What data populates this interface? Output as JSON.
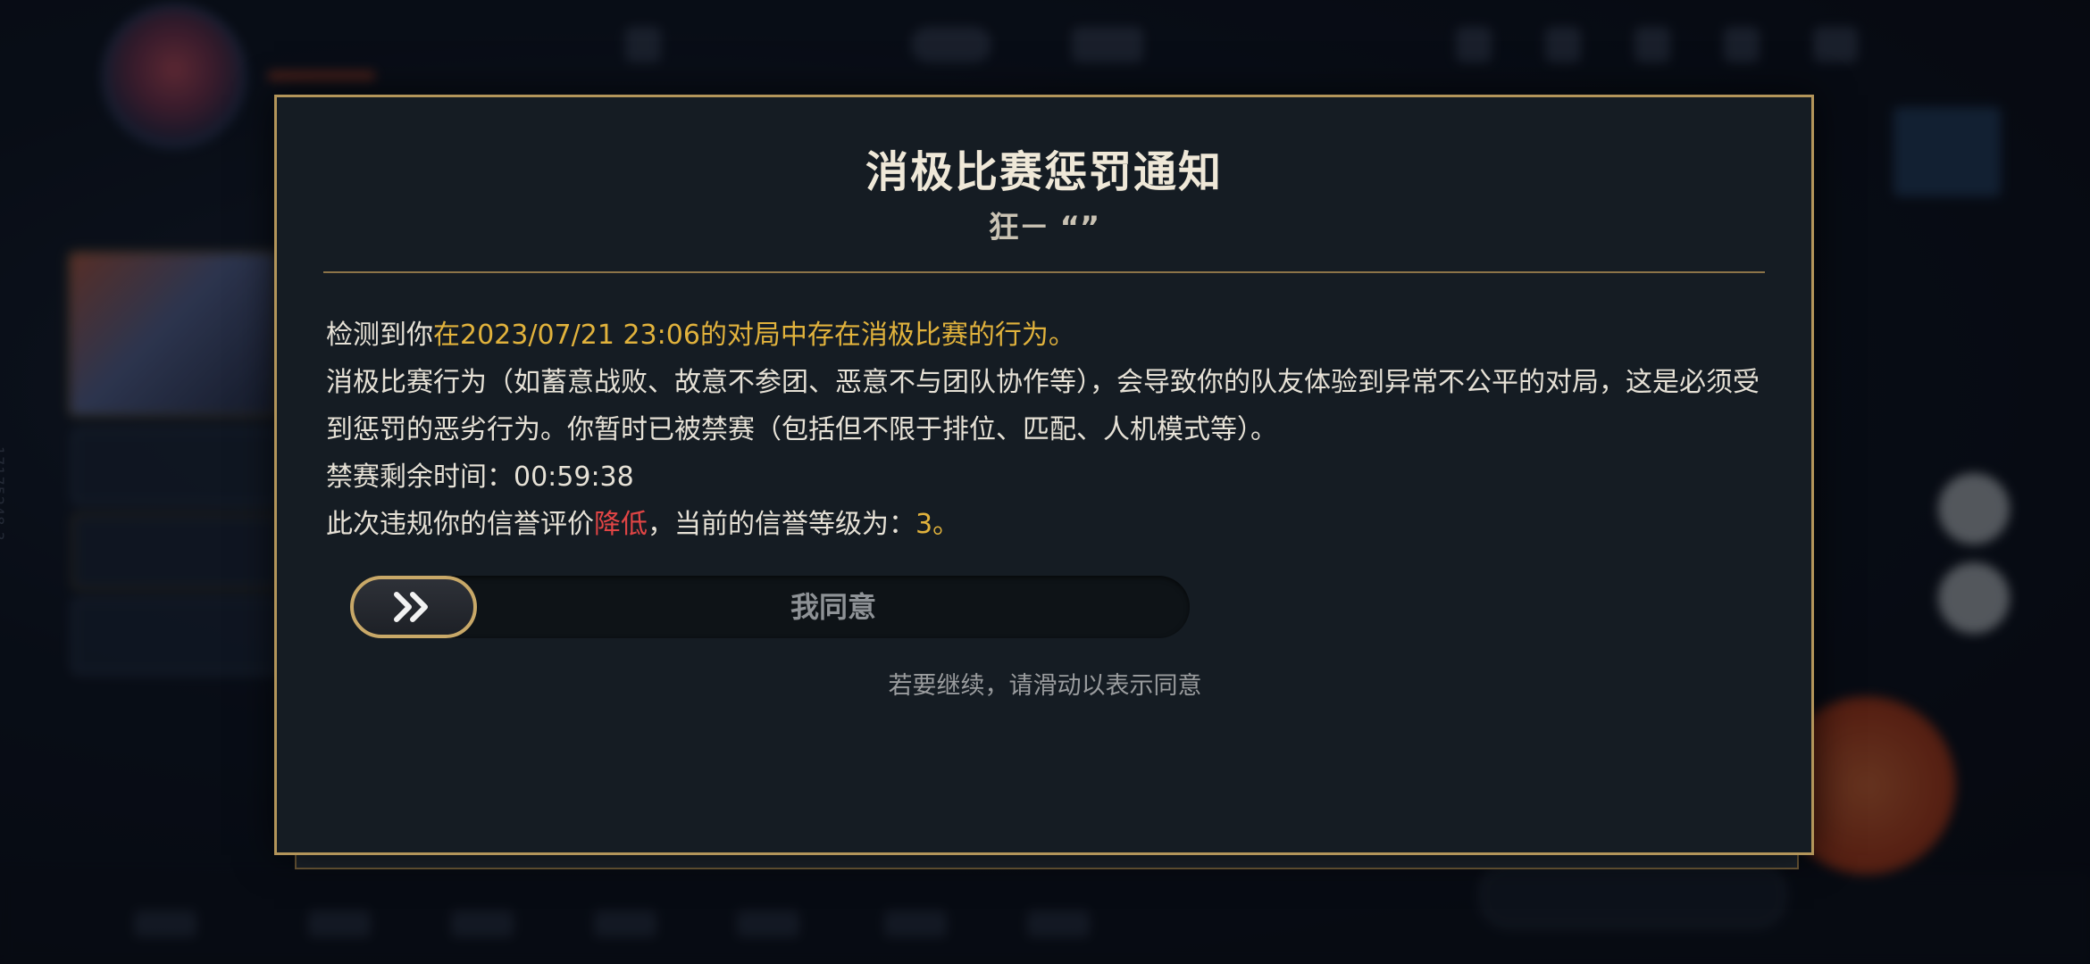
{
  "background": {
    "side_id": "17175248 3"
  },
  "dialog": {
    "title": "消极比赛惩罚通知",
    "subtitle": "狂－ “”",
    "line1_prefix": "检测到你",
    "line1_highlight": "在2023/07/21 23:06的对局中存在消极比赛的行为。",
    "line2": "消极比赛行为（如蓄意战败、故意不参团、恶意不与团队协作等），会导致你的队友体验到异常不公平的对局，这是必须受到惩罚的恶劣行为。你暂时已被禁赛（包括但不限于排位、匹配、人机模式等）。",
    "line3": "禁赛剩余时间：00:59:38",
    "line4_prefix": "此次违规你的信誉评价",
    "line4_highlight_red": "降低",
    "line4_middle": "，当前的信誉等级为：",
    "line4_highlight_gold": "3。",
    "slider_label": "我同意",
    "slider_hint": "若要继续，请滑动以表示同意"
  },
  "colors": {
    "border_gold": "#b3955a",
    "highlight_gold": "#e1b23c",
    "highlight_red": "#e14545"
  },
  "icons": {
    "slider_handle": "double-chevron-right-icon"
  }
}
